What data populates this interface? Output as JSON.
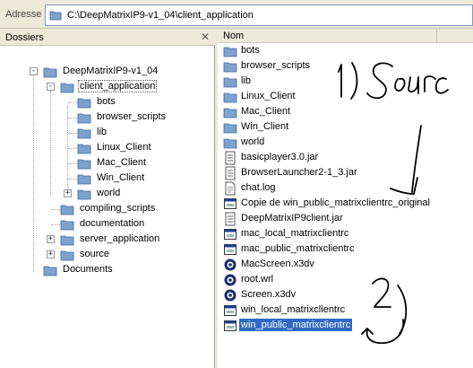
{
  "address_bar": {
    "label": "Adresse",
    "path": "C:\\DeepMatrixIP9-v1_04\\client_application"
  },
  "folders_pane": {
    "title": "Dossiers",
    "tree": [
      {
        "label": "DeepMatrixIP9-v1_04",
        "expander": "-"
      },
      {
        "label": "client_application",
        "expander": "-",
        "selected": true
      },
      {
        "label": "bots"
      },
      {
        "label": "browser_scripts"
      },
      {
        "label": "lib"
      },
      {
        "label": "Linux_Client"
      },
      {
        "label": "Mac_Client"
      },
      {
        "label": "Win_Client"
      },
      {
        "label": "world",
        "expander": "+"
      },
      {
        "label": "compiling_scripts"
      },
      {
        "label": "documentation"
      },
      {
        "label": "server_application",
        "expander": "+"
      },
      {
        "label": "source",
        "expander": "+"
      },
      {
        "label": "Documents"
      }
    ]
  },
  "files_pane": {
    "column_name": "Nom",
    "files": [
      {
        "name": "bots",
        "icon": "folder-icon"
      },
      {
        "name": "browser_scripts",
        "icon": "folder-icon"
      },
      {
        "name": "lib",
        "icon": "folder-icon"
      },
      {
        "name": "Linux_Client",
        "icon": "folder-icon"
      },
      {
        "name": "Mac_Client",
        "icon": "folder-icon"
      },
      {
        "name": "Win_Client",
        "icon": "folder-icon"
      },
      {
        "name": "world",
        "icon": "folder-icon"
      },
      {
        "name": "basicplayer3.0.jar",
        "icon": "jar-icon"
      },
      {
        "name": "BrowserLauncher2-1_3.jar",
        "icon": "jar-icon"
      },
      {
        "name": "chat.log",
        "icon": "text-file-icon"
      },
      {
        "name": "Copie de win_public_matrixclientrc_original",
        "icon": "window-file-icon"
      },
      {
        "name": "DeepMatrixIP9client.jar",
        "icon": "jar-icon"
      },
      {
        "name": "mac_local_matrixclientrc",
        "icon": "window-file-icon"
      },
      {
        "name": "mac_public_matrixclientrc",
        "icon": "window-file-icon"
      },
      {
        "name": "MacScreen.x3dv",
        "icon": "x3d-icon"
      },
      {
        "name": "root.wrl",
        "icon": "x3d-icon"
      },
      {
        "name": "Screen.x3dv",
        "icon": "x3d-icon"
      },
      {
        "name": "win_local_matrixclientrc",
        "icon": "window-file-icon"
      },
      {
        "name": "win_public_matrixclientrc",
        "icon": "window-file-icon",
        "selected": true
      }
    ]
  },
  "annotations": {
    "note_1": "1) Source",
    "note_2": "2)",
    "ink_color": "#000000"
  }
}
